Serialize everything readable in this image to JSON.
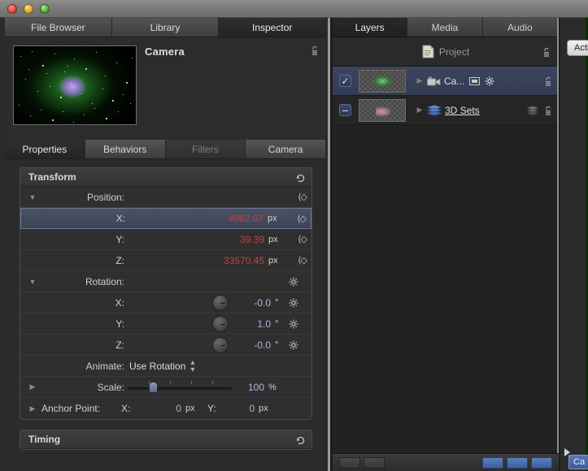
{
  "window": {
    "traffic_lights": [
      "close",
      "minimize",
      "zoom"
    ]
  },
  "left_pane": {
    "top_tabs": [
      {
        "label": "File Browser",
        "active": false
      },
      {
        "label": "Library",
        "active": false
      },
      {
        "label": "Inspector",
        "active": true
      }
    ],
    "inspector_title": "Camera",
    "lock_icon": "lock-icon",
    "sub_tabs": [
      {
        "label": "Properties",
        "active": true,
        "disabled": false
      },
      {
        "label": "Behaviors",
        "active": false,
        "disabled": false
      },
      {
        "label": "Filters",
        "active": false,
        "disabled": true
      },
      {
        "label": "Camera",
        "active": false,
        "disabled": false
      }
    ],
    "transform": {
      "title": "Transform",
      "reset_icon": "reset-arrow-icon",
      "position": {
        "label": "Position:",
        "disclosure": "▼",
        "axes": [
          {
            "label": "X:",
            "value": "4082.07",
            "unit": "px",
            "selected": true
          },
          {
            "label": "Y:",
            "value": "39.39",
            "unit": "px",
            "selected": false
          },
          {
            "label": "Z:",
            "value": "33570.45",
            "unit": "px",
            "selected": false
          }
        ]
      },
      "rotation": {
        "label": "Rotation:",
        "disclosure": "▼",
        "axes": [
          {
            "label": "X:",
            "value": "-0.0",
            "unit": "°"
          },
          {
            "label": "Y:",
            "value": "1.0",
            "unit": "°"
          },
          {
            "label": "Z:",
            "value": "-0.0",
            "unit": "°"
          }
        ],
        "animate": {
          "label": "Animate:",
          "value": "Use Rotation"
        }
      },
      "scale": {
        "label": "Scale:",
        "value": "100",
        "unit": "%",
        "disclosure": "▶"
      },
      "anchor_point": {
        "label": "Anchor Point:",
        "disclosure": "▶",
        "x_label": "X:",
        "x_value": "0",
        "x_unit": "px",
        "y_label": "Y:",
        "y_value": "0",
        "y_unit": "px"
      }
    },
    "timing": {
      "title": "Timing",
      "reset_icon": "reset-arrow-icon"
    }
  },
  "right_pane": {
    "tabs": [
      {
        "label": "Layers",
        "active": true
      },
      {
        "label": "Media",
        "active": false
      },
      {
        "label": "Audio",
        "active": false
      }
    ],
    "rows": [
      {
        "kind": "project",
        "name": "Project",
        "icon": "project-document-icon",
        "lock": "lock-icon"
      },
      {
        "kind": "layer",
        "checkbox": "checked",
        "name": "Ca...",
        "type_icon": "camera-icon",
        "extra_icons": [
          "frame-icon",
          "gear-icon"
        ],
        "disclosure": "▶",
        "lock": "lock-icon",
        "selected": true
      },
      {
        "kind": "layer",
        "checkbox": "mixed",
        "name": "3D Sets",
        "type_icon": "layers-group-icon",
        "extra_icons": [
          "layers-shadow-icon"
        ],
        "disclosure": "▶",
        "lock": "lock-icon",
        "selected": false
      }
    ]
  },
  "canvas_pane": {
    "action_button": "Acti",
    "chip_label": "Ca",
    "play_icon": "play-icon"
  },
  "colors": {
    "accent_blue": "#3f5b94",
    "value_red": "#c8413c",
    "value_blue": "#aab8d6",
    "selection": "#434b60",
    "panel_bg": "#2f2f2f"
  }
}
